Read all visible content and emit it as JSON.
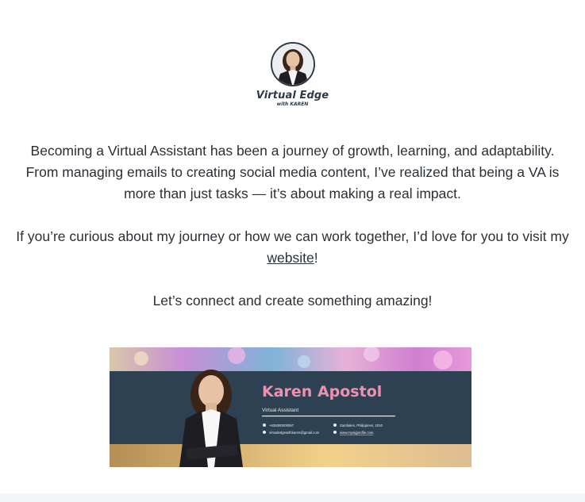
{
  "logo": {
    "title": "Virtual Edge",
    "subtitle": "with KAREN",
    "avatar_icon": "profile-photo"
  },
  "intro": {
    "paragraph1": "Becoming a Virtual Assistant has been a journey of growth, learning, and adaptability. From managing emails to creating social media content, I’ve realized that being a VA is more than just tasks — it’s about making a real impact.",
    "paragraph2_before": "If you’re curious about my journey or how we can work together, I’d love for you to visit my ",
    "paragraph2_link": "website",
    "paragraph2_after": "!",
    "paragraph3": "Let’s connect and create something amazing!"
  },
  "signature": {
    "name": "Karen Apostol",
    "role": "Virtual Assistant",
    "phone": "+639380000067",
    "location": "Zambales, Philippines, 2010",
    "email": "virtualedgewithkaren@gmail.com",
    "website": "www.mysigprofile.com",
    "colors": {
      "panel": "#2e4152",
      "name": "#f08fb0",
      "text": "#e8edf2"
    }
  }
}
